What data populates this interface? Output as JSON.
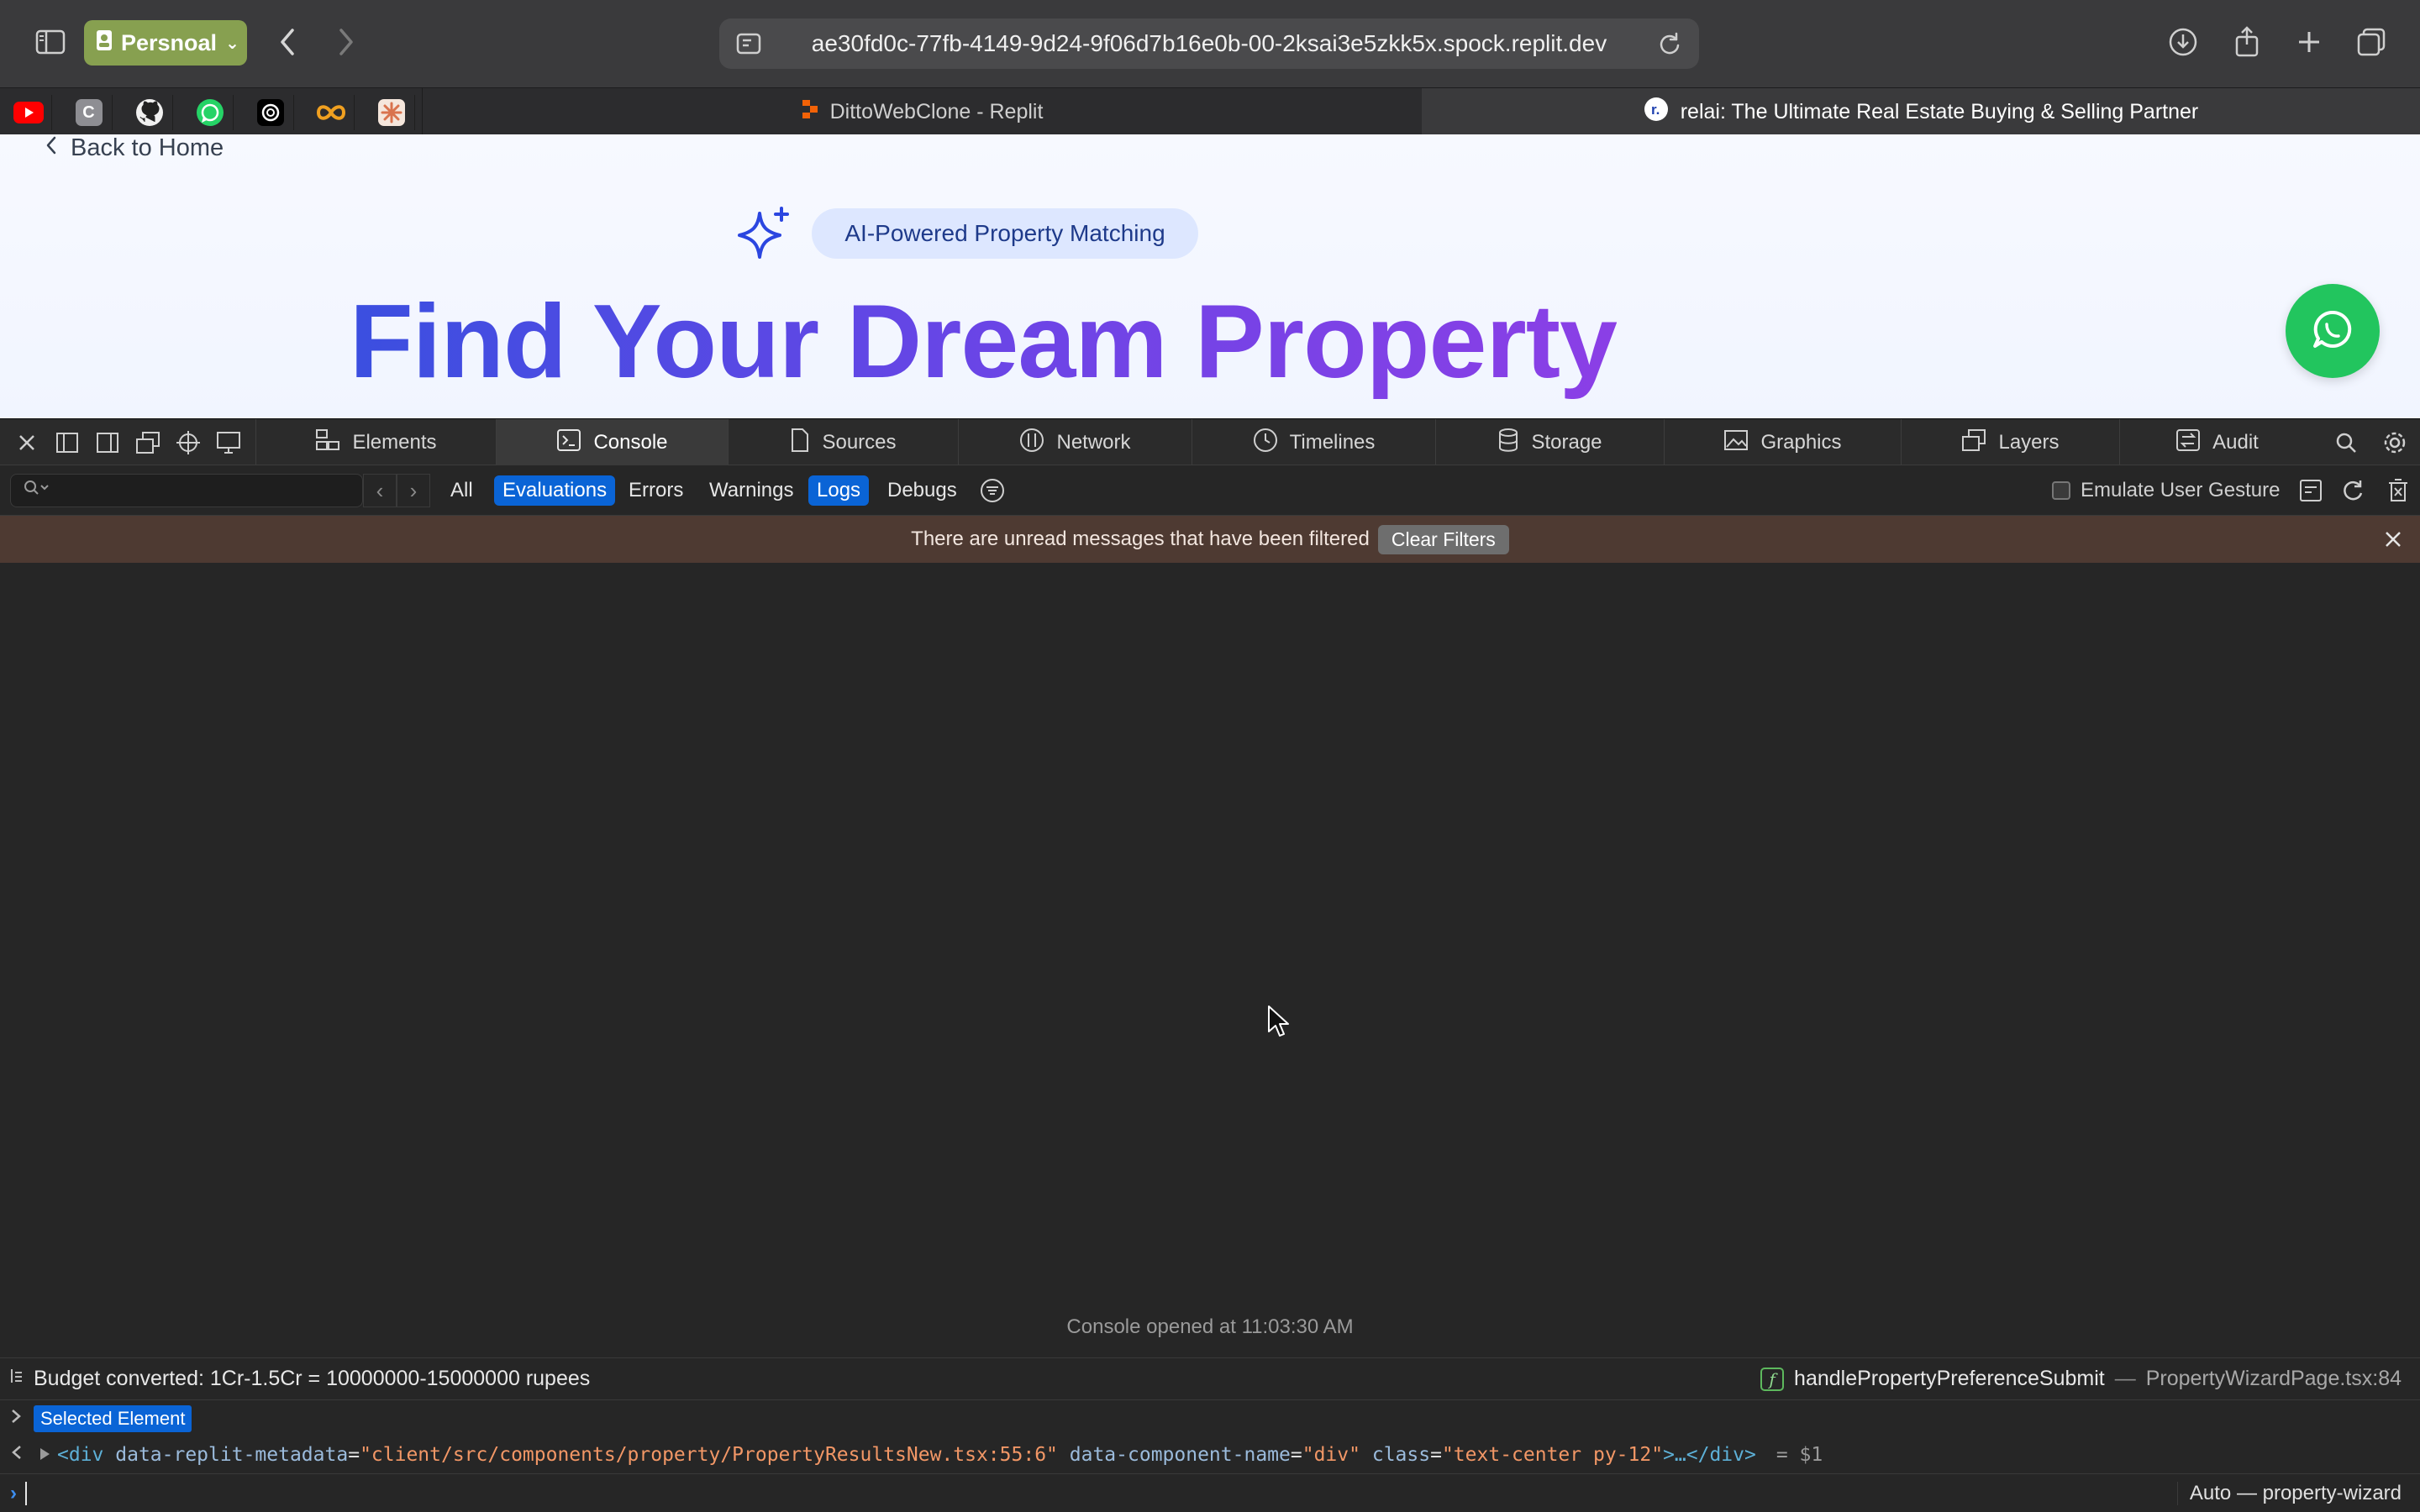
{
  "browser": {
    "profile_label": "Persnoal",
    "url": "ae30fd0c-77fb-4149-9d24-9f06d7b16e0b-00-2ksai3e5zkk5x.spock.replit.dev",
    "favorites": [
      "youtube",
      "c",
      "github",
      "whatsapp",
      "openai",
      "infinity",
      "claude"
    ],
    "tabs": [
      {
        "label": "DittoWebClone - Replit",
        "active": false
      },
      {
        "label": "relai: The Ultimate Real Estate Buying & Selling Partner",
        "active": true
      }
    ]
  },
  "page": {
    "back_label": "Back to Home",
    "badge": "AI-Powered Property Matching",
    "hero_title": "Find Your Dream Property"
  },
  "devtools": {
    "tabs": [
      "Elements",
      "Console",
      "Sources",
      "Network",
      "Timelines",
      "Storage",
      "Graphics",
      "Layers",
      "Audit"
    ],
    "selected_tab": "Console",
    "filters": {
      "all": "All",
      "evaluations": "Evaluations",
      "errors": "Errors",
      "warnings": "Warnings",
      "logs": "Logs",
      "debugs": "Debugs"
    },
    "emulate_label": "Emulate User Gesture",
    "banner_text": "There are unread messages that have been filtered",
    "clear_filters": "Clear Filters"
  },
  "console": {
    "opened": "Console opened at 11:03:30 AM",
    "log_message": "Budget converted: 1Cr-1.5Cr = 10000000-15000000 rupees",
    "log_function": "handlePropertyPreferenceSubmit",
    "log_dash": "—",
    "log_file": "PropertyWizardPage.tsx:84",
    "selected_element_label": "Selected Element",
    "node": {
      "open": "<div",
      "attr1_name": "data-replit-metadata",
      "attr1_value": "\"client/src/components/property/PropertyResultsNew.tsx:55:6\"",
      "attr2_name": "data-component-name",
      "attr2_value": "\"div\"",
      "attr3_name": "class",
      "attr3_value": "\"text-center py-12\"",
      "close": ">…</div>",
      "ref": "= $1"
    },
    "context": "Auto — property-wizard"
  },
  "colors": {
    "accent": "#0a64d6",
    "hero_gradient_start": "#3b4fe0",
    "hero_gradient_end": "#8b3fe6",
    "chat_button": "#22c55e",
    "banner_bg": "#4e3a32"
  }
}
